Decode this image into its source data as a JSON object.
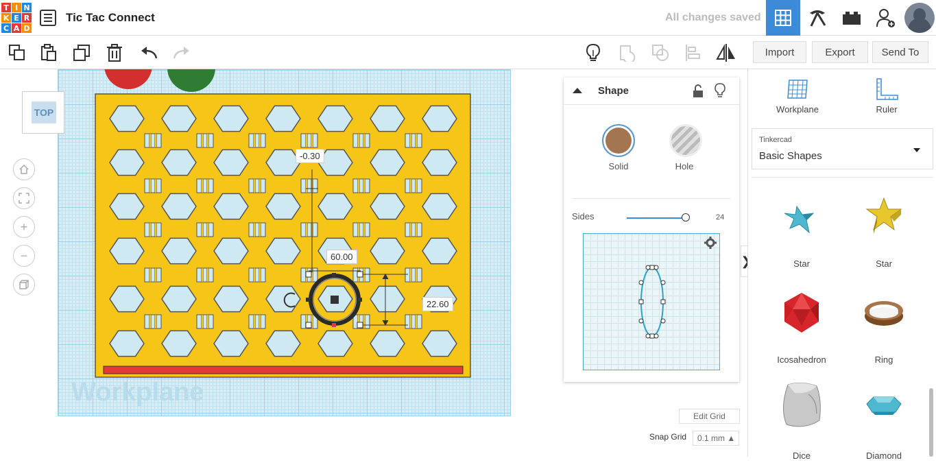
{
  "app": {
    "logo_letters": [
      "T",
      "I",
      "N",
      "K",
      "E",
      "R",
      "C",
      "A",
      "D"
    ],
    "logo_colors": [
      "#e53935",
      "#fb8c00",
      "#1e88e5",
      "#fb8c00",
      "#1e88e5",
      "#e53935",
      "#1e88e5",
      "#e53935",
      "#fb8c00"
    ],
    "title": "Tic Tac Connect",
    "save_status": "All changes saved"
  },
  "toolbar": {
    "import_label": "Import",
    "export_label": "Export",
    "send_to_label": "Send To"
  },
  "canvas": {
    "view_label": "TOP",
    "workplane_watermark": "Workplane",
    "dim_top": "-0.30",
    "dim_width": "60.00",
    "dim_height": "22.60",
    "board_color": "#f5c518",
    "board_bar_color": "#e53935",
    "piece_colors": [
      "#d32f2f",
      "#2e7d32"
    ]
  },
  "shape_panel": {
    "title": "Shape",
    "solid_label": "Solid",
    "hole_label": "Hole",
    "solid_color": "#a47551",
    "sides_label": "Sides",
    "sides_value": "24"
  },
  "grid_controls": {
    "edit_grid_label": "Edit Grid",
    "snap_grid_label": "Snap Grid",
    "snap_grid_value": "0.1 mm ▲"
  },
  "right_panel": {
    "workplane_label": "Workplane",
    "ruler_label": "Ruler",
    "library_source": "Tinkercad",
    "library_name": "Basic Shapes",
    "shapes": [
      {
        "label": "Star",
        "icon": "star-icon"
      },
      {
        "label": "Star",
        "icon": "star-icon"
      },
      {
        "label": "Icosahedron",
        "icon": "icosahedron-icon"
      },
      {
        "label": "Ring",
        "icon": "ring-icon"
      },
      {
        "label": "Dice",
        "icon": "dice-icon"
      },
      {
        "label": "Diamond",
        "icon": "diamond-icon"
      }
    ]
  }
}
